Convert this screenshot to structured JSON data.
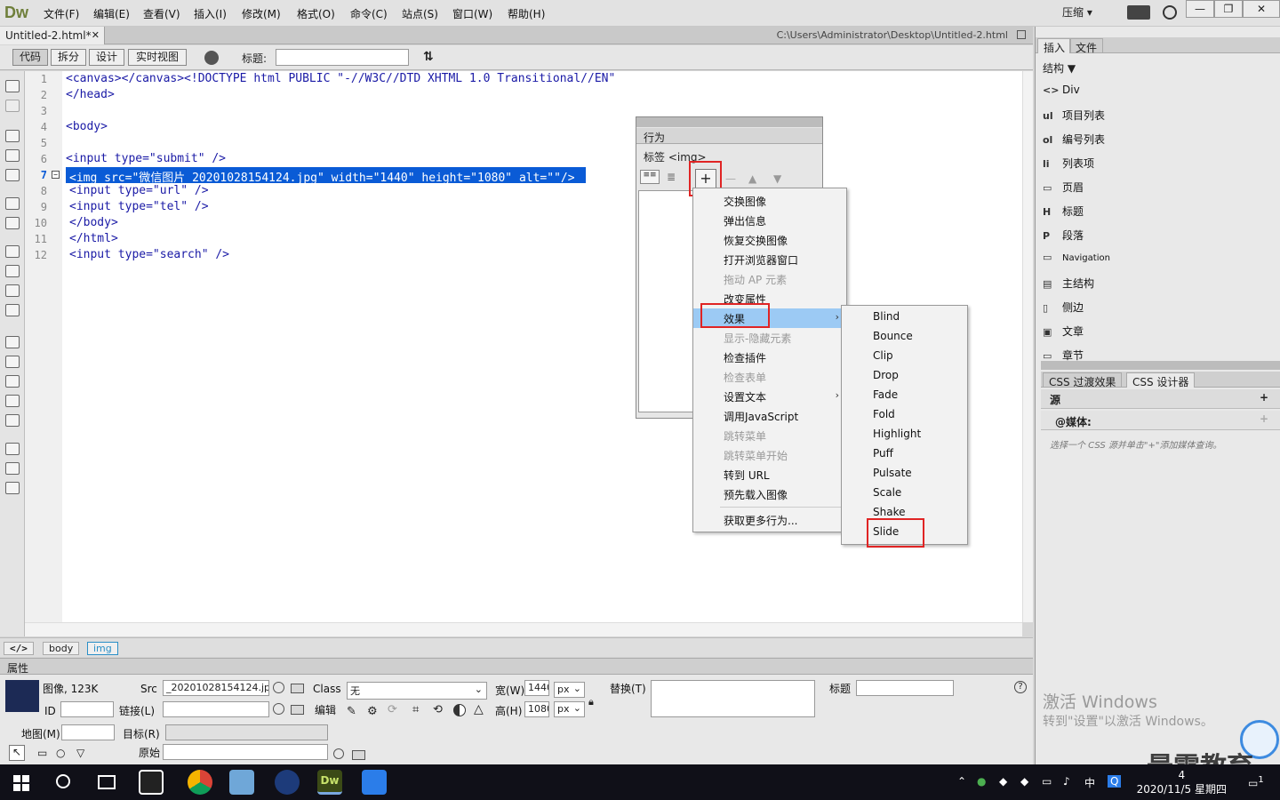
{
  "app": {
    "logo": "Dw"
  },
  "menubar": {
    "items": [
      "文件(F)",
      "编辑(E)",
      "查看(V)",
      "插入(I)",
      "修改(M)",
      "格式(O)",
      "命令(C)",
      "站点(S)",
      "窗口(W)",
      "帮助(H)"
    ],
    "compress": "压缩",
    "compress_arrow": "▾"
  },
  "doc": {
    "tab": "Untitled-2.html*",
    "close": "✕",
    "path": "C:\\Users\\Administrator\\Desktop\\Untitled-2.html"
  },
  "toolbar": {
    "views": [
      "代码",
      "拆分",
      "设计",
      "实时视图"
    ],
    "title_label": "标题:",
    "title_value": ""
  },
  "editor": {
    "line_numbers": [
      "1",
      "2",
      "3",
      "4",
      "5",
      "6",
      "7",
      "8",
      "9",
      "10",
      "11",
      "12"
    ],
    "lines": [
      "<canvas></canvas><!DOCTYPE html PUBLIC \"-//W3C//DTD XHTML 1.0 Transitional//EN\"",
      "</head>",
      "",
      "<body>",
      "",
      "<input type=\"submit\" />",
      "<img src=\"微信图片_20201028154124.jpg\" width=\"1440\" height=\"1080\" alt=\"\"/>",
      "<input type=\"url\" />",
      "<input type=\"tel\" />",
      "</body>",
      "</html>",
      "<input type=\"search\" />"
    ],
    "selected_line": 7
  },
  "tag_selector": {
    "code_icon": "</>",
    "tags": [
      "body",
      "img"
    ]
  },
  "properties": {
    "title": "属性",
    "kind": "图像, 123K",
    "id_label": "ID",
    "id_value": "",
    "src_label": "Src",
    "src_value": "_20201028154124.jpg",
    "link_label": "链接(L)",
    "link_value": "",
    "class_label": "Class",
    "class_value": "无",
    "edit_label": "编辑",
    "width_label": "宽(W)",
    "width_value": "1440",
    "height_label": "高(H)",
    "height_value": "1080",
    "unit": "px",
    "alt_label": "替换(T)",
    "alt_value": "",
    "title_label": "标题",
    "title_value": "",
    "map_label": "地图(M)",
    "target_label": "目标(R)",
    "original_label": "原始"
  },
  "right_panel": {
    "tabs": [
      "插入",
      "文件"
    ],
    "category": "结构",
    "items": [
      {
        "icon": "<>",
        "label": "Div"
      },
      {
        "icon": "ul",
        "label": "项目列表"
      },
      {
        "icon": "ol",
        "label": "编号列表"
      },
      {
        "icon": "li",
        "label": "列表项"
      },
      {
        "icon": "▭",
        "label": "页眉"
      },
      {
        "icon": "H",
        "label": "标题"
      },
      {
        "icon": "P",
        "label": "段落"
      },
      {
        "icon": "▭",
        "label": "Navigation"
      },
      {
        "icon": "▤",
        "label": "主结构"
      },
      {
        "icon": "▯",
        "label": "侧边"
      },
      {
        "icon": "▣",
        "label": "文章"
      },
      {
        "icon": "▭",
        "label": "章节"
      }
    ],
    "css_tabs": [
      "CSS 过渡效果",
      "CSS 设计器"
    ],
    "source_label": "源",
    "media_label": "@媒体:",
    "css_hint": "选择一个 CSS 源并单击\"+\"添加媒体查询。",
    "activate_title": "激活 Windows",
    "activate_sub": "转到\"设置\"以激活 Windows。",
    "watermark": "最需教育"
  },
  "behaviors": {
    "title": "行为",
    "tag_label": "标签 <img>",
    "plus": "+"
  },
  "context_menu": {
    "items": [
      {
        "label": "交换图像",
        "disabled": false
      },
      {
        "label": "弹出信息",
        "disabled": false
      },
      {
        "label": "恢复交换图像",
        "disabled": false
      },
      {
        "label": "打开浏览器窗口",
        "disabled": false
      },
      {
        "label": "拖动 AP 元素",
        "disabled": true
      },
      {
        "label": "改变属性",
        "disabled": false
      },
      {
        "label": "效果",
        "disabled": false,
        "highlighted": true,
        "submenu": true
      },
      {
        "label": "显示-隐藏元素",
        "disabled": true
      },
      {
        "label": "检查插件",
        "disabled": false
      },
      {
        "label": "检查表单",
        "disabled": true
      },
      {
        "label": "设置文本",
        "disabled": false,
        "submenu": true
      },
      {
        "label": "调用JavaScript",
        "disabled": false
      },
      {
        "label": "跳转菜单",
        "disabled": true
      },
      {
        "label": "跳转菜单开始",
        "disabled": true
      },
      {
        "label": "转到 URL",
        "disabled": false
      },
      {
        "label": "预先载入图像",
        "disabled": false
      }
    ],
    "more": "获取更多行为...",
    "submenu_arrow": "›"
  },
  "effects_submenu": [
    "Blind",
    "Bounce",
    "Clip",
    "Drop",
    "Fade",
    "Fold",
    "Highlight",
    "Puff",
    "Pulsate",
    "Scale",
    "Shake",
    "Slide"
  ],
  "taskbar": {
    "time": "4",
    "date": "2020/11/5 星期四",
    "ime": "中",
    "notification_count": "1"
  },
  "colors": {
    "selection": "#0a5bd6",
    "highlight_menu": "#9ccaf4",
    "annotation_red": "#e02424"
  }
}
